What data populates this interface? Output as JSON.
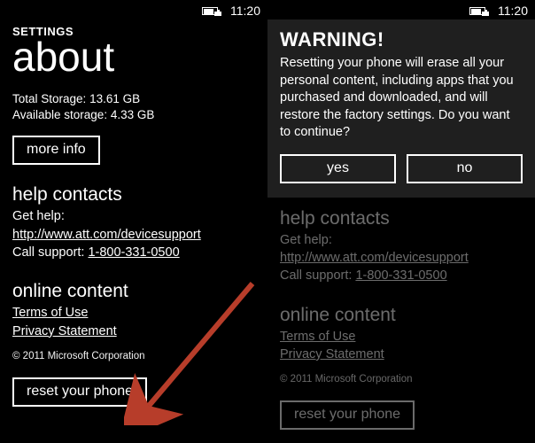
{
  "statusbar": {
    "time": "11:20"
  },
  "left": {
    "crumb": "SETTINGS",
    "title": "about",
    "storage_total_label": "Total Storage:",
    "storage_total_value": "13.61 GB",
    "storage_avail_label": "Available storage:",
    "storage_avail_value": "4.33 GB",
    "more_info_label": "more info",
    "help_heading": "help contacts",
    "get_help_label": "Get help:",
    "get_help_link": "http://www.att.com/devicesupport",
    "call_support_label": "Call support:",
    "call_support_number": "1-800-331-0500",
    "online_heading": "online content",
    "terms_label": "Terms of Use",
    "privacy_label": "Privacy Statement",
    "copyright": "© 2011 Microsoft Corporation",
    "reset_label": "reset your phone"
  },
  "right": {
    "warning_title": "WARNING!",
    "warning_body": "Resetting your phone will erase all your personal content, including apps that you purchased and downloaded, and will restore the factory settings. Do you want to continue?",
    "yes_label": "yes",
    "no_label": "no",
    "help_heading": "help contacts",
    "get_help_label": "Get help:",
    "get_help_link": "http://www.att.com/devicesupport",
    "call_support_label": "Call support:",
    "call_support_number": "1-800-331-0500",
    "online_heading": "online content",
    "terms_label": "Terms of Use",
    "privacy_label": "Privacy Statement",
    "copyright": "© 2011 Microsoft Corporation",
    "reset_label": "reset your phone"
  }
}
